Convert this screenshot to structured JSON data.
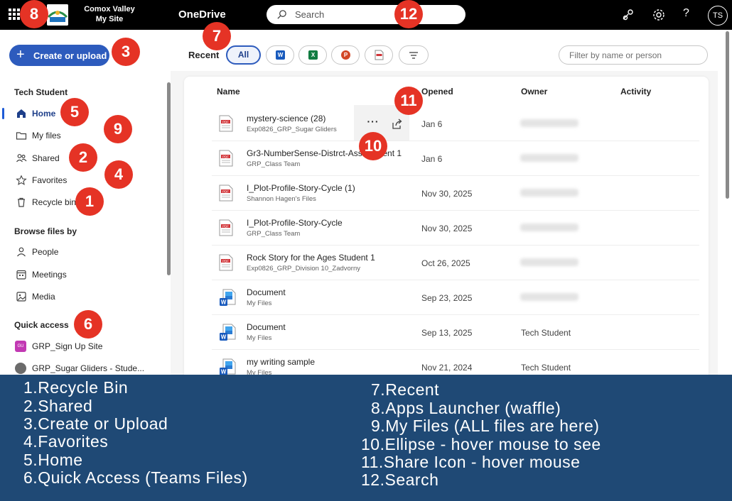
{
  "topbar": {
    "site_name_line1": "Comox Valley",
    "site_name_line2": "My Site",
    "app_name": "OneDrive",
    "search_placeholder": "Search",
    "help_label": "?",
    "avatar_initials": "TS"
  },
  "sidebar": {
    "create_label": "Create or upload",
    "user_name": "Tech Student",
    "nav_items": [
      {
        "label": "Home",
        "icon": "home-icon",
        "active": true
      },
      {
        "label": "My files",
        "icon": "folder-icon"
      },
      {
        "label": "Shared",
        "icon": "people-icon"
      },
      {
        "label": "Favorites",
        "icon": "star-icon"
      },
      {
        "label": "Recycle bin",
        "icon": "trash-icon"
      }
    ],
    "browse_heading": "Browse files by",
    "browse_items": [
      {
        "label": "People",
        "icon": "person-icon"
      },
      {
        "label": "Meetings",
        "icon": "calendar-icon"
      },
      {
        "label": "Media",
        "icon": "image-icon"
      }
    ],
    "quick_access_heading": "Quick access",
    "quick_access_items": [
      {
        "label": "GRP_Sign Up Site",
        "icon_text": "GU",
        "color": "#c239b3"
      },
      {
        "label": "GRP_Sugar Gliders - Stude...",
        "icon_text": "",
        "color": "#6b6b6b"
      }
    ]
  },
  "filters": {
    "recent_label": "Recent",
    "all_label": "All",
    "filter_placeholder": "Filter by name or person"
  },
  "table": {
    "headers": {
      "name": "Name",
      "opened": "Opened",
      "owner": "Owner",
      "activity": "Activity"
    },
    "rows": [
      {
        "name": "mystery-science (28)",
        "location": "Exp0826_GRP_Sugar Gliders",
        "opened": "Jan 6",
        "owner": "",
        "type": "pdf"
      },
      {
        "name": "Gr3-NumberSense-Distrct-Assessment 1",
        "location": "GRP_Class Team",
        "opened": "Jan 6",
        "owner": "",
        "type": "pdf"
      },
      {
        "name": "I_Plot-Profile-Story-Cycle (1)",
        "location": "Shannon Hagen's Files",
        "opened": "Nov 30, 2025",
        "owner": "",
        "type": "pdf"
      },
      {
        "name": "I_Plot-Profile-Story-Cycle",
        "location": "GRP_Class Team",
        "opened": "Nov 30, 2025",
        "owner": "",
        "type": "pdf"
      },
      {
        "name": "Rock Story for the Ages Student 1",
        "location": "Exp0826_GRP_Division 10_Zadvorny",
        "opened": "Oct 26, 2025",
        "owner": "",
        "type": "pdf"
      },
      {
        "name": "Document",
        "location": "My Files",
        "opened": "Sep 23, 2025",
        "owner": "",
        "type": "word"
      },
      {
        "name": "Document",
        "location": "My Files",
        "opened": "Sep 13, 2025",
        "owner": "Tech Student",
        "type": "word"
      },
      {
        "name": "my writing sample",
        "location": "My Files",
        "opened": "Nov 21, 2024",
        "owner": "Tech Student",
        "type": "word"
      }
    ],
    "ellipse_label": "···"
  },
  "badges": [
    "1",
    "2",
    "3",
    "4",
    "5",
    "6",
    "7",
    "8",
    "9",
    "10",
    "11",
    "12"
  ],
  "legend": {
    "left": [
      {
        "num": "1.",
        "text": "Recycle Bin"
      },
      {
        "num": "2.",
        "text": "Shared"
      },
      {
        "num": "3.",
        "text": "Create or Upload"
      },
      {
        "num": "4.",
        "text": "Favorites"
      },
      {
        "num": "5.",
        "text": "Home"
      },
      {
        "num": "6.",
        "text": "Quick Access (Teams Files)"
      }
    ],
    "right": [
      {
        "num": "7.",
        "text": "Recent"
      },
      {
        "num": "8.",
        "text": "Apps Launcher (waffle)"
      },
      {
        "num": "9.",
        "text": "My Files (ALL files are here)"
      },
      {
        "num": "10.",
        "text": "Ellipse - hover mouse to see"
      },
      {
        "num": "11.",
        "text": "Share Icon - hover mouse"
      },
      {
        "num": "12.",
        "text": "Search"
      }
    ]
  },
  "colors": {
    "badge": "#e53325",
    "legend_bg": "#1f4975",
    "primary": "#2d5bbd",
    "pdf_red": "#d13438",
    "word_blue": "#185abd"
  }
}
